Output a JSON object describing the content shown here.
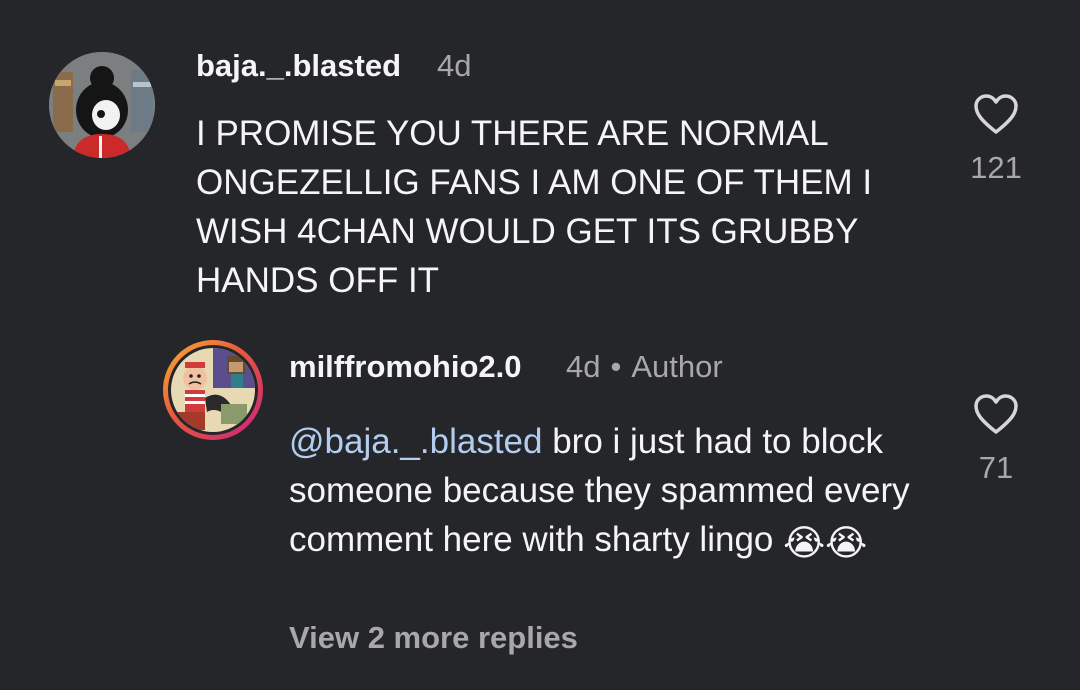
{
  "comment": {
    "username": "baja._.blasted",
    "age": "4d",
    "text": "I PROMISE YOU THERE ARE NORMAL ONGEZELLIG FANS I AM ONE OF THEM I WISH 4CHAN WOULD GET ITS GRUBBY HANDS OFF IT",
    "likes": "121",
    "avatar_icon": "avatar-hooded-girl-icon",
    "like_icon": "heart-outline-icon"
  },
  "reply": {
    "username": "milffromohio2.0",
    "age": "4d",
    "separator": "•",
    "badge": "Author",
    "mention": "@baja._.blasted",
    "text": " bro i just had to block someone because they spammed every comment here with sharty lingo ",
    "emojis": "😭😭",
    "likes": "71",
    "avatar_icon": "avatar-cartoon-collage-icon",
    "like_icon": "heart-outline-icon"
  },
  "view_more": "View 2 more replies",
  "colors": {
    "background": "#25262a",
    "text": "#f5f5f5",
    "secondary": "#a8a8a8",
    "mention": "#b3cdf0",
    "story_ring_start": "#f9b233",
    "story_ring_end": "#c8237e"
  }
}
